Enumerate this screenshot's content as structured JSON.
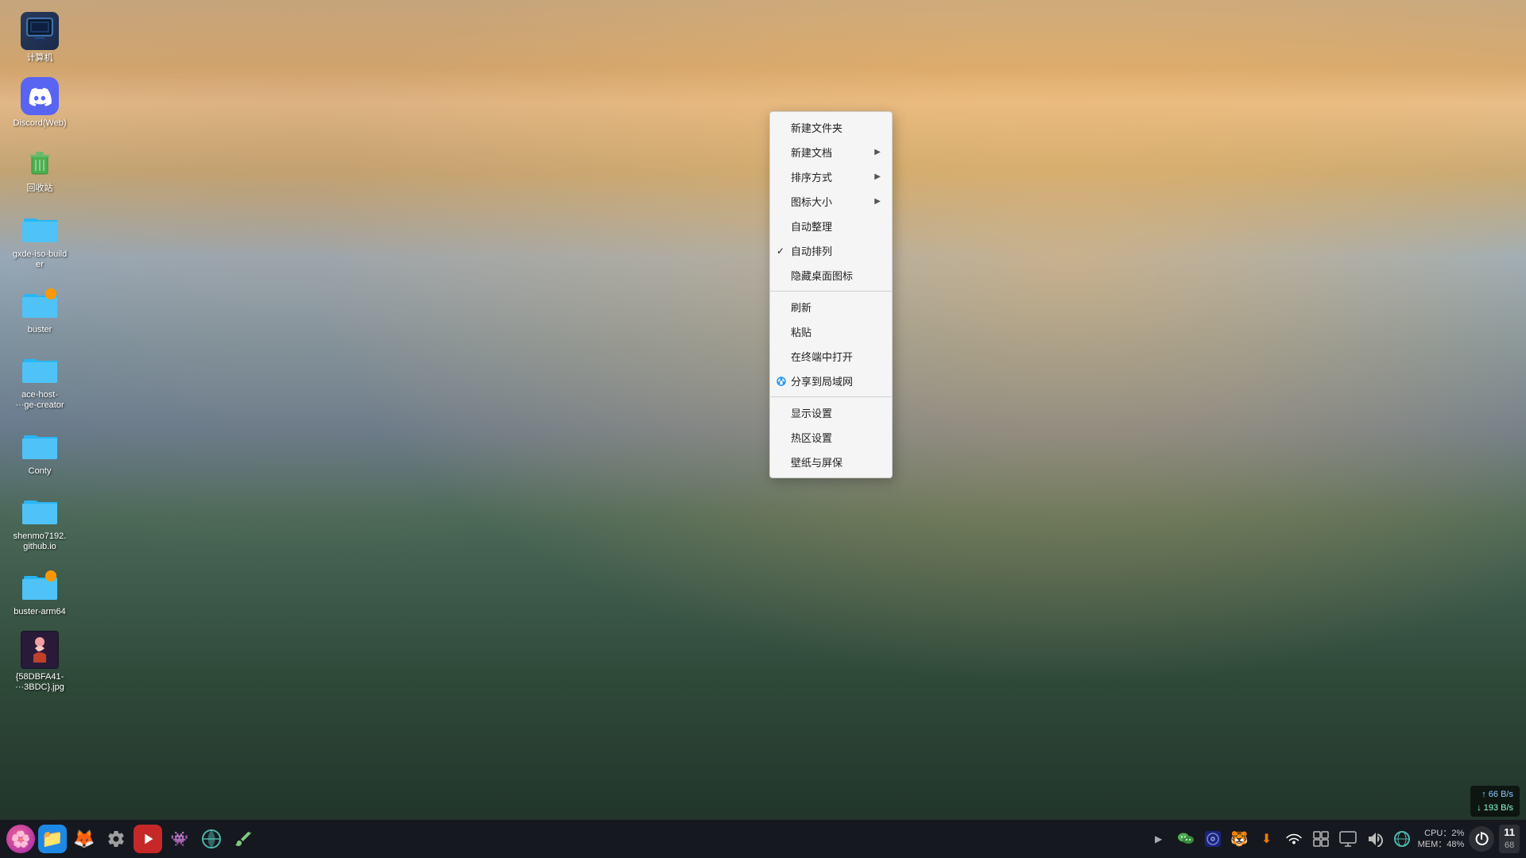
{
  "desktop": {
    "icons": [
      {
        "id": "computer",
        "label": "计算机",
        "type": "computer"
      },
      {
        "id": "discord",
        "label": "Discord(Web)",
        "type": "discord"
      },
      {
        "id": "trash",
        "label": "回收站",
        "type": "trash"
      },
      {
        "id": "gxde-iso",
        "label": "gxde-iso-builder",
        "type": "folder-teal"
      },
      {
        "id": "buster",
        "label": "buster",
        "type": "folder-orange-dot"
      },
      {
        "id": "ace-host",
        "label": "ace-host-···ge-creator",
        "type": "folder"
      },
      {
        "id": "conty",
        "label": "Conty",
        "type": "folder"
      },
      {
        "id": "shenmo",
        "label": "shenmo7192.github.io",
        "type": "folder"
      },
      {
        "id": "buster-arm64",
        "label": "buster-arm64",
        "type": "folder-orange-dot"
      },
      {
        "id": "jpg-file",
        "label": "{58DBFA41-···3BDC}.jpg",
        "type": "image"
      }
    ]
  },
  "context_menu": {
    "items": [
      {
        "label": "新建文件夹",
        "hasArrow": false,
        "hasCheck": false,
        "hasIcon": false,
        "separator_after": false
      },
      {
        "label": "新建文档",
        "hasArrow": true,
        "hasCheck": false,
        "hasIcon": false,
        "separator_after": false
      },
      {
        "label": "排序方式",
        "hasArrow": true,
        "hasCheck": false,
        "hasIcon": false,
        "separator_after": false
      },
      {
        "label": "图标大小",
        "hasArrow": true,
        "hasCheck": false,
        "hasIcon": false,
        "separator_after": false
      },
      {
        "label": "自动整理",
        "hasArrow": false,
        "hasCheck": false,
        "hasIcon": false,
        "separator_after": false
      },
      {
        "label": "自动排列",
        "hasArrow": false,
        "hasCheck": true,
        "hasIcon": false,
        "separator_after": false
      },
      {
        "label": "隐藏桌面图标",
        "hasArrow": false,
        "hasCheck": false,
        "hasIcon": false,
        "separator_after": true
      },
      {
        "label": "刷新",
        "hasArrow": false,
        "hasCheck": false,
        "hasIcon": false,
        "separator_after": false
      },
      {
        "label": "粘贴",
        "hasArrow": false,
        "hasCheck": false,
        "hasIcon": false,
        "separator_after": false
      },
      {
        "label": "在终端中打开",
        "hasArrow": false,
        "hasCheck": false,
        "hasIcon": false,
        "separator_after": false
      },
      {
        "label": "分享到局域网",
        "hasArrow": false,
        "hasCheck": false,
        "hasIcon": true,
        "separator_after": true
      },
      {
        "label": "显示设置",
        "hasArrow": false,
        "hasCheck": false,
        "hasIcon": false,
        "separator_after": false
      },
      {
        "label": "热区设置",
        "hasArrow": false,
        "hasCheck": false,
        "hasIcon": false,
        "separator_after": false
      },
      {
        "label": "壁纸与屏保",
        "hasArrow": false,
        "hasCheck": false,
        "hasIcon": false,
        "separator_after": false
      }
    ]
  },
  "taskbar": {
    "apps": [
      {
        "id": "deepin-launcher",
        "label": "启动器",
        "icon": "🌸",
        "class": "tb-deepin"
      },
      {
        "id": "files",
        "label": "文件管理器",
        "icon": "📁",
        "class": "tb-files"
      },
      {
        "id": "firefox",
        "label": "Firefox",
        "icon": "🦊",
        "class": "tb-firefox"
      },
      {
        "id": "settings",
        "label": "系统设置",
        "icon": "⚙",
        "class": "tb-settings"
      },
      {
        "id": "screen-recorder",
        "label": "录屏",
        "icon": "▶",
        "class": "tb-screen"
      },
      {
        "id": "steam",
        "label": "Steam",
        "icon": "👾",
        "class": "tb-steam"
      },
      {
        "id": "deepin-network",
        "label": "网络",
        "icon": "🌐",
        "class": "tb-deepin-green"
      },
      {
        "id": "paint",
        "label": "画图",
        "icon": "🎨",
        "class": "tb-paint"
      }
    ],
    "tray": [
      {
        "id": "arrow-btn",
        "label": "展开",
        "icon": "▶"
      },
      {
        "id": "wechat",
        "label": "微信",
        "icon": "💬"
      },
      {
        "id": "deepin-music",
        "label": "音乐",
        "icon": "🎵"
      },
      {
        "id": "tiger",
        "label": "应用",
        "icon": "🐯"
      },
      {
        "id": "download",
        "label": "下载",
        "icon": "⬇"
      },
      {
        "id": "wifi",
        "label": "WiFi",
        "icon": "📶"
      },
      {
        "id": "taskview",
        "label": "任务视图",
        "icon": "⊞"
      },
      {
        "id": "screen2",
        "label": "屏幕",
        "icon": "🖥"
      },
      {
        "id": "volume",
        "label": "音量",
        "icon": "🔊"
      },
      {
        "id": "network2",
        "label": "网络2",
        "icon": "🌐"
      }
    ]
  },
  "system_stats": {
    "cpu_label": "CPU：2%",
    "mem_label": "MEM：48%"
  },
  "net_speed": {
    "up": "↑ 66 B/s",
    "down": "↓ 193 B/s"
  },
  "time": {
    "line1": "11",
    "line2": "68"
  }
}
